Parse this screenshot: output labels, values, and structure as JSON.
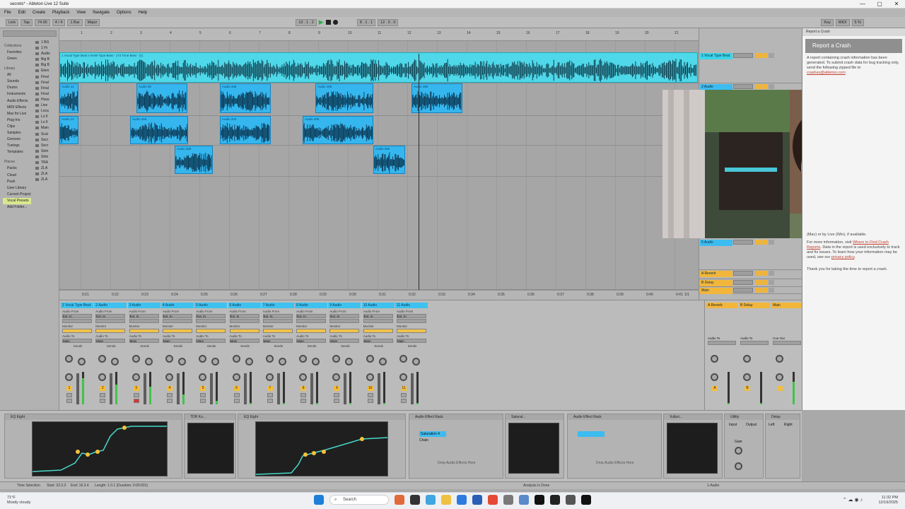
{
  "window": {
    "title": "secrets* - Ableton Live 12 Suite",
    "controls": [
      "—",
      "▢",
      "✕"
    ]
  },
  "menu": [
    "File",
    "Edit",
    "Create",
    "Playback",
    "View",
    "Navigate",
    "Options",
    "Help"
  ],
  "transport": {
    "link": "Link",
    "tap": "Tap",
    "tempo": "74.00",
    "signature": "4 / 4",
    "metronome": "1 Bar",
    "key": "Major",
    "position": "13 . 1 . 2",
    "loop_start": "8 . 1 . 1",
    "loop_length": "12 . 0 . 0",
    "key_map": "Key",
    "midi_map": "MIDI",
    "cpu": "5 %"
  },
  "browser": {
    "search_placeholder": "Search",
    "groups": {
      "collections": "Collections",
      "library": "Library",
      "places": "Places"
    },
    "collections": [
      "Favorites",
      "Green"
    ],
    "library": [
      "All",
      "Sounds",
      "Drums",
      "Instruments",
      "Audio Effects",
      "MIDI Effects",
      "Max for Live",
      "Plug-Ins",
      "Clips",
      "Samples",
      "Grooves",
      "Tunings",
      "Templates"
    ],
    "places": [
      "Packs",
      "Cloud",
      "Push",
      "User Library",
      "Current Project",
      "Vocal Presets",
      "Add Folder..."
    ],
    "places_selected": "Vocal Presets",
    "files": [
      "1 BG",
      "1 Hi",
      "Audio",
      "Big B",
      "Big B",
      "Elem",
      "Final",
      "Final",
      "Final",
      "Final",
      "Hous",
      "Live",
      "Loca",
      "Lo fi",
      "Lo fi",
      "Main",
      "Scal",
      "Secr",
      "Secr",
      "Strin",
      "Strin",
      "TRA",
      "ZLA",
      "ZLA",
      "ZLA"
    ]
  },
  "arrangement": {
    "ruler_labels": [
      "1",
      "2",
      "3",
      "4",
      "5",
      "6",
      "7",
      "8",
      "9",
      "10",
      "11",
      "12",
      "13",
      "14",
      "15",
      "16",
      "17",
      "18",
      "19",
      "20",
      "21"
    ],
    "time_labels": [
      "0:21",
      "0:22",
      "0:23",
      "0:24",
      "0:25",
      "0:26",
      "0:27",
      "0:28",
      "0:29",
      "0:30",
      "0:31",
      "0:32",
      "0:33",
      "0:34",
      "0:35",
      "0:36",
      "0:37",
      "0:38",
      "0:39",
      "0:40",
      "0:41"
    ],
    "loop_fraction": "1/1",
    "top_clip": "1 Vocal Type Beat x RAW Type Beat - 174 Time Beat - (1)",
    "clips": [
      {
        "name": "Audio 12",
        "row": 1,
        "start": 0.0,
        "end": 0.03
      },
      {
        "name": "Audio 39",
        "row": 1,
        "start": 0.12,
        "end": 0.2
      },
      {
        "name": "Audio 168",
        "row": 1,
        "start": 0.25,
        "end": 0.33
      },
      {
        "name": "Audio 190",
        "row": 1,
        "start": 0.4,
        "end": 0.49
      },
      {
        "name": "Audio 195",
        "row": 1,
        "start": 0.55,
        "end": 0.63
      },
      {
        "name": "Audio 12",
        "row": 2,
        "start": 0.0,
        "end": 0.03
      },
      {
        "name": "Audio 265",
        "row": 2,
        "start": 0.11,
        "end": 0.2
      },
      {
        "name": "Audio 204",
        "row": 2,
        "start": 0.25,
        "end": 0.33
      },
      {
        "name": "Audio 286",
        "row": 2,
        "start": 0.38,
        "end": 0.49
      },
      {
        "name": "Audio 289",
        "row": 3,
        "start": 0.18,
        "end": 0.24
      },
      {
        "name": "Audio 292",
        "row": 3,
        "start": 0.49,
        "end": 0.54
      }
    ]
  },
  "track_headers": [
    {
      "name": "1 Vocal Type Beat",
      "color": "#38d6ea"
    },
    {
      "name": "2 Audio",
      "color": "#3cbcf0"
    },
    {
      "name": "3 Audio",
      "color": "#3cbcf0"
    },
    {
      "name": "4 Audio",
      "color": "#3cbcf0"
    },
    {
      "name": "5 Audio",
      "color": "#3cbcf0"
    },
    {
      "name": "A Reverb",
      "color": "#f2b63a"
    },
    {
      "name": "B Delay",
      "color": "#f2b63a"
    },
    {
      "name": "Main",
      "color": "#f2b63a"
    }
  ],
  "mixer": {
    "strips": [
      {
        "name": "1 Vocal Type Beat",
        "num": "1"
      },
      {
        "name": "2 Audio",
        "num": "2"
      },
      {
        "name": "3 Audio",
        "num": "3"
      },
      {
        "name": "4 Audio",
        "num": "4"
      },
      {
        "name": "5 Audio",
        "num": "5"
      },
      {
        "name": "6 Audio",
        "num": "6"
      },
      {
        "name": "7 Audio",
        "num": "7"
      },
      {
        "name": "8 Audio",
        "num": "8"
      },
      {
        "name": "9 Audio",
        "num": "9"
      },
      {
        "name": "10 Audio",
        "num": "10"
      },
      {
        "name": "11 Audio",
        "num": "11"
      }
    ],
    "labels": {
      "audio_from": "Audio From",
      "ext_in": "Ext. In",
      "monitor": "Monitor",
      "in": "In",
      "auto": "Auto",
      "off": "Off",
      "audio_to": "Audio To",
      "main": "Main",
      "sends": "Sends"
    },
    "returns": [
      {
        "name": "A Reverb",
        "num": "A"
      },
      {
        "name": "B Delay",
        "num": "B"
      },
      {
        "name": "Main",
        "num": ""
      }
    ],
    "cue_out": "Cue Out",
    "main_out": "Main Out"
  },
  "crash_panel": {
    "tab": "Report a Crash",
    "title": "Report a Crash",
    "body_1": "A report containing crash information has been generated. To submit crash data for bug tracking only, send the following zipped file to",
    "email": "crashes@ableton.com",
    "body_2": "(Mac) or by Live (Win), if available.",
    "body_3": "For more information, visit",
    "link": "Where to Find Crash Reports",
    "body_4": ". Data in the report is used exclusively to track and fix issues. To learn how your information may be used, see our",
    "privacy": "privacy policy",
    "thanks": "Thank you for taking the time to report a crash."
  },
  "devices": [
    {
      "name": "EQ Eight"
    },
    {
      "name": "TDR Ko..."
    },
    {
      "name": "EQ Eight"
    },
    {
      "name": "Audio Effect Rack"
    },
    {
      "name": "Saturat..."
    },
    {
      "name": "Audio Effect Rack"
    },
    {
      "name": "Vulturi..."
    },
    {
      "name": "Utility"
    },
    {
      "name": "Delay"
    }
  ],
  "device_texts": {
    "drop_1": "Drop Audio Effects Here",
    "drop_2": "Drop Audio Effects Here",
    "saturation": "Saturation 4",
    "chain": "Chain",
    "gain": "Gain",
    "width": "Width",
    "output": "Output",
    "input": "Input",
    "left": "Left",
    "right": "Right",
    "mode": "Mode"
  },
  "status": {
    "left": "Time Selection",
    "start": "Start: 23.3.3",
    "end": "End: 16.3.4",
    "length": "Length: 1.0.1 (Duration: 0:00:001)",
    "analysis": "Analysis Is Done",
    "track": "1-Audio"
  },
  "taskbar": {
    "temp": "71°F",
    "weather": "Mostly cloudy",
    "search": "Search",
    "time": "11:32 PM",
    "date": "12/19/2025"
  }
}
